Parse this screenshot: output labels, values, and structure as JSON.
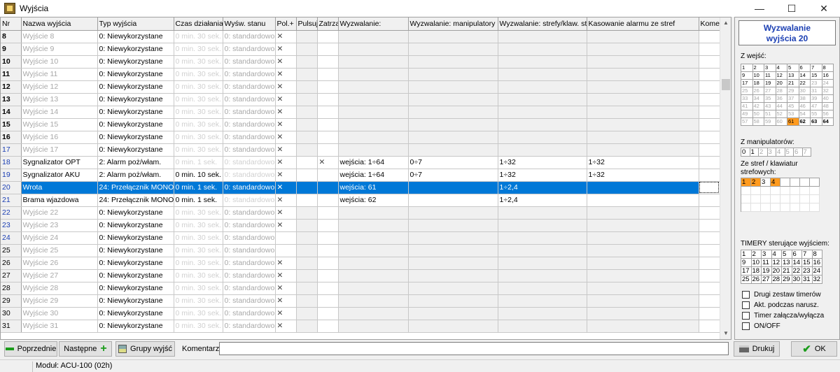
{
  "window": {
    "title": "Wyjścia",
    "controls": [
      "—",
      "☐",
      "✕"
    ]
  },
  "columns": [
    "Nr",
    "Nazwa wyjścia",
    "Typ wyjścia",
    "Czas działania",
    "Wyśw. stanu",
    "Pol.+",
    "Pulsuj",
    "Zatrza",
    "Wyzwalanie:",
    "Wyzwalanie: manipulatory",
    "Wyzwalanie: strefy/klaw. stref.",
    "Kasowanie alarmu ze stref",
    "Komen"
  ],
  "rows": [
    {
      "nr": "8",
      "name": "Wyjście   8",
      "type": "0: Niewykorzystane",
      "time": "0  min. 30 sek.",
      "display": "0: standardowo",
      "pol": "✕",
      "puls": "",
      "latch": "",
      "trig": "",
      "manip": "",
      "zones": "",
      "reset": "",
      "comment": ""
    },
    {
      "nr": "9",
      "name": "Wyjście   9",
      "type": "0: Niewykorzystane",
      "time": "0  min. 30 sek.",
      "display": "0: standardowo",
      "pol": "✕",
      "puls": "",
      "latch": "",
      "trig": "",
      "manip": "",
      "zones": "",
      "reset": "",
      "comment": ""
    },
    {
      "nr": "10",
      "name": "Wyjście  10",
      "type": "0: Niewykorzystane",
      "time": "0  min. 30 sek.",
      "display": "0: standardowo",
      "pol": "✕",
      "puls": "",
      "latch": "",
      "trig": "",
      "manip": "",
      "zones": "",
      "reset": "",
      "comment": ""
    },
    {
      "nr": "11",
      "name": "Wyjście  11",
      "type": "0: Niewykorzystane",
      "time": "0  min. 30 sek.",
      "display": "0: standardowo",
      "pol": "✕",
      "puls": "",
      "latch": "",
      "trig": "",
      "manip": "",
      "zones": "",
      "reset": "",
      "comment": ""
    },
    {
      "nr": "12",
      "name": "Wyjście  12",
      "type": "0: Niewykorzystane",
      "time": "0  min. 30 sek.",
      "display": "0: standardowo",
      "pol": "✕",
      "puls": "",
      "latch": "",
      "trig": "",
      "manip": "",
      "zones": "",
      "reset": "",
      "comment": ""
    },
    {
      "nr": "13",
      "name": "Wyjście  13",
      "type": "0: Niewykorzystane",
      "time": "0  min. 30 sek.",
      "display": "0: standardowo",
      "pol": "✕",
      "puls": "",
      "latch": "",
      "trig": "",
      "manip": "",
      "zones": "",
      "reset": "",
      "comment": ""
    },
    {
      "nr": "14",
      "name": "Wyjście  14",
      "type": "0: Niewykorzystane",
      "time": "0  min. 30 sek.",
      "display": "0: standardowo",
      "pol": "✕",
      "puls": "",
      "latch": "",
      "trig": "",
      "manip": "",
      "zones": "",
      "reset": "",
      "comment": ""
    },
    {
      "nr": "15",
      "name": "Wyjście  15",
      "type": "0: Niewykorzystane",
      "time": "0  min. 30 sek.",
      "display": "0: standardowo",
      "pol": "✕",
      "puls": "",
      "latch": "",
      "trig": "",
      "manip": "",
      "zones": "",
      "reset": "",
      "comment": ""
    },
    {
      "nr": "16",
      "name": "Wyjście  16",
      "type": "0: Niewykorzystane",
      "time": "0  min. 30 sek.",
      "display": "0: standardowo",
      "pol": "✕",
      "puls": "",
      "latch": "",
      "trig": "",
      "manip": "",
      "zones": "",
      "reset": "",
      "comment": ""
    },
    {
      "nr": "17",
      "name": "Wyjście  17",
      "type": "0: Niewykorzystane",
      "time": "0  min. 30 sek.",
      "display": "0: standardowo",
      "pol": "✕",
      "puls": "",
      "latch": "",
      "trig": "",
      "manip": "",
      "zones": "",
      "reset": "",
      "comment": "",
      "nrstyle": "blue"
    },
    {
      "nr": "18",
      "name": "Sygnalizator OPT",
      "type": "2: Alarm poż/włam.",
      "time": "0  min.  1  sek.",
      "display": "0: standardowo",
      "pol": "✕",
      "puls": "",
      "latch": "✕",
      "trig": "wejścia: 1÷64",
      "manip": "0÷7",
      "zones": "1÷32",
      "reset": "1÷32",
      "comment": "",
      "nrstyle": "blue",
      "active": true,
      "timegray": true
    },
    {
      "nr": "19",
      "name": "Sygnalizator AKU",
      "type": "2: Alarm poż/włam.",
      "time": "0  min. 10 sek.",
      "display": "0: standardowo",
      "pol": "✕",
      "puls": "",
      "latch": "",
      "trig": "wejścia: 1÷64",
      "manip": "0÷7",
      "zones": "1÷32",
      "reset": "1÷32",
      "comment": "",
      "nrstyle": "blue",
      "active": true
    },
    {
      "nr": "20",
      "name": "Wrota",
      "type": "24: Przełącznik MONO",
      "time": "0  min.  1  sek.",
      "display": "0: standardowo",
      "pol": "✕",
      "puls": "",
      "latch": "",
      "trig": "wejścia: 61",
      "manip": "",
      "zones": "1÷2,4",
      "reset": "",
      "comment": "",
      "nrstyle": "blue",
      "selected": true
    },
    {
      "nr": "21",
      "name": "Brama wjazdowa",
      "type": "24: Przełącznik MONO",
      "time": "0  min.  1  sek.",
      "display": "0: standardowo",
      "pol": "✕",
      "puls": "",
      "latch": "",
      "trig": "wejścia: 62",
      "manip": "",
      "zones": "1÷2,4",
      "reset": "",
      "comment": "",
      "nrstyle": "blue",
      "active": true
    },
    {
      "nr": "22",
      "name": "Wyjście  22",
      "type": "0: Niewykorzystane",
      "time": "0  min. 30 sek.",
      "display": "0: standardowo",
      "pol": "✕",
      "puls": "",
      "latch": "",
      "trig": "",
      "manip": "",
      "zones": "",
      "reset": "",
      "comment": "",
      "nrstyle": "blue"
    },
    {
      "nr": "23",
      "name": "Wyjście  23",
      "type": "0: Niewykorzystane",
      "time": "0  min. 30 sek.",
      "display": "0: standardowo",
      "pol": "✕",
      "puls": "",
      "latch": "",
      "trig": "",
      "manip": "",
      "zones": "",
      "reset": "",
      "comment": "",
      "nrstyle": "blue"
    },
    {
      "nr": "24",
      "name": "Wyjście  24",
      "type": "0: Niewykorzystane",
      "time": "0  min. 30 sek.",
      "display": "0: standardowo",
      "pol": "",
      "puls": "",
      "latch": "",
      "trig": "",
      "manip": "",
      "zones": "",
      "reset": "",
      "comment": "",
      "nrstyle": "blue"
    },
    {
      "nr": "25",
      "name": "Wyjście  25",
      "type": "0: Niewykorzystane",
      "time": "0  min. 30 sek.",
      "display": "0: standardowo",
      "pol": "",
      "puls": "",
      "latch": "",
      "trig": "",
      "manip": "",
      "zones": "",
      "reset": "",
      "comment": "",
      "nrstyle": "plain"
    },
    {
      "nr": "26",
      "name": "Wyjście  26",
      "type": "0: Niewykorzystane",
      "time": "0  min. 30 sek.",
      "display": "0: standardowo",
      "pol": "✕",
      "puls": "",
      "latch": "",
      "trig": "",
      "manip": "",
      "zones": "",
      "reset": "",
      "comment": "",
      "nrstyle": "plain"
    },
    {
      "nr": "27",
      "name": "Wyjście  27",
      "type": "0: Niewykorzystane",
      "time": "0  min. 30 sek.",
      "display": "0: standardowo",
      "pol": "✕",
      "puls": "",
      "latch": "",
      "trig": "",
      "manip": "",
      "zones": "",
      "reset": "",
      "comment": "",
      "nrstyle": "plain"
    },
    {
      "nr": "28",
      "name": "Wyjście  28",
      "type": "0: Niewykorzystane",
      "time": "0  min. 30 sek.",
      "display": "0: standardowo",
      "pol": "✕",
      "puls": "",
      "latch": "",
      "trig": "",
      "manip": "",
      "zones": "",
      "reset": "",
      "comment": "",
      "nrstyle": "plain"
    },
    {
      "nr": "29",
      "name": "Wyjście  29",
      "type": "0: Niewykorzystane",
      "time": "0  min. 30 sek.",
      "display": "0: standardowo",
      "pol": "✕",
      "puls": "",
      "latch": "",
      "trig": "",
      "manip": "",
      "zones": "",
      "reset": "",
      "comment": "",
      "nrstyle": "plain"
    },
    {
      "nr": "30",
      "name": "Wyjście  30",
      "type": "0: Niewykorzystane",
      "time": "0  min. 30 sek.",
      "display": "0: standardowo",
      "pol": "✕",
      "puls": "",
      "latch": "",
      "trig": "",
      "manip": "",
      "zones": "",
      "reset": "",
      "comment": "",
      "nrstyle": "plain"
    },
    {
      "nr": "31",
      "name": "Wyjście  31",
      "type": "0: Niewykorzystane",
      "time": "0  min. 30 sek.",
      "display": "0: standardowo",
      "pol": "✕",
      "puls": "",
      "latch": "",
      "trig": "",
      "manip": "",
      "zones": "",
      "reset": "",
      "comment": "",
      "nrstyle": "plain"
    }
  ],
  "panel": {
    "title": "Wyzwalanie\nwyjścia 20",
    "inputs_label": "Z wejść:",
    "inputs": [
      "1",
      "2",
      "3",
      "4",
      "5",
      "6",
      "7",
      "8",
      "9",
      "10",
      "11",
      "12",
      "13",
      "14",
      "15",
      "16",
      "17",
      "18",
      "19",
      "20",
      "21",
      "22",
      "23",
      "24",
      "25",
      "26",
      "27",
      "28",
      "29",
      "30",
      "31",
      "32",
      "33",
      "34",
      "35",
      "36",
      "37",
      "38",
      "39",
      "40",
      "41",
      "42",
      "43",
      "44",
      "45",
      "46",
      "47",
      "48",
      "49",
      "50",
      "51",
      "52",
      "53",
      "54",
      "55",
      "56",
      "57",
      "58",
      "59",
      "60",
      "61",
      "62",
      "63",
      "64"
    ],
    "inputs_active": [
      1,
      2,
      3,
      4,
      5,
      6,
      7,
      8,
      9,
      10,
      11,
      12,
      13,
      14,
      15,
      16,
      17,
      18,
      19,
      20,
      21,
      22,
      61,
      62,
      63,
      64
    ],
    "inputs_selected": [
      61
    ],
    "manip_label": "Z manipulatorów:",
    "manip": [
      "0",
      "1",
      "2",
      "3",
      "4",
      "5",
      "6",
      "7"
    ],
    "zones_label": "Ze stref / klawiatur strefowych:",
    "zones": [
      "1",
      "2",
      "3",
      "4",
      "",
      "",
      "",
      "",
      "",
      "",
      "",
      "",
      "",
      "",
      "",
      "",
      "",
      "",
      "",
      "",
      "",
      "",
      "",
      "",
      "",
      "",
      "",
      "",
      "",
      "",
      "",
      ""
    ],
    "zones_selected": [
      1,
      2,
      4
    ],
    "timers_label": "TIMERY sterujące wyjściem:",
    "timers": [
      "1",
      "2",
      "3",
      "4",
      "5",
      "6",
      "7",
      "8",
      "9",
      "10",
      "11",
      "12",
      "13",
      "14",
      "15",
      "16",
      "17",
      "18",
      "19",
      "20",
      "21",
      "22",
      "23",
      "24",
      "25",
      "26",
      "27",
      "28",
      "29",
      "30",
      "31",
      "32"
    ],
    "options": [
      "Drugi zestaw timerów",
      "Akt. podczas narusz.",
      "Timer załącza/wyłącza",
      "ON/OFF"
    ]
  },
  "bottom": {
    "prev_label": "Poprzednie",
    "next_label": "Następne",
    "groups_label": "Grupy wyjść",
    "comment_label": "Komentarz:",
    "comment_value": "",
    "print_label": "Drukuj",
    "ok_label": "OK"
  },
  "status": {
    "module": "Moduł: ACU-100   (02h)"
  },
  "colors": {
    "selection": "#0078d7",
    "accent_orange": "#ff9a1e",
    "blue_text": "#1b3fb3",
    "ok_green": "#1b9c1b"
  }
}
